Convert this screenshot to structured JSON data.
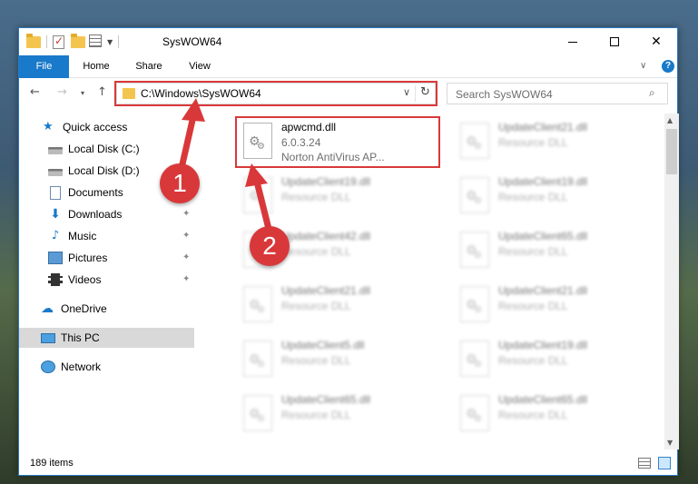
{
  "window": {
    "title": "SysWOW64",
    "minimize_icon": "minimize-icon",
    "maximize_icon": "maximize-icon",
    "close_icon": "close-icon",
    "close_glyph": "✕"
  },
  "ribbon": {
    "tabs": [
      {
        "label": "File"
      },
      {
        "label": "Home"
      },
      {
        "label": "Share"
      },
      {
        "label": "View"
      }
    ],
    "help_glyph": "?"
  },
  "nav": {
    "back_glyph": "←",
    "forward_glyph": "→",
    "recent_glyph": "▾",
    "up_glyph": "↑",
    "address": "C:\\Windows\\SysWOW64",
    "address_drop_glyph": "∨",
    "refresh_glyph": "↻",
    "search_placeholder": "Search SysWOW64",
    "search_glyph": "⌕"
  },
  "sidebar": {
    "items": [
      {
        "label": "Quick access",
        "icon": "star-icon",
        "pinned": false
      },
      {
        "label": "Local Disk (C:)",
        "icon": "disk-icon",
        "pinned": false
      },
      {
        "label": "Local Disk (D:)",
        "icon": "disk-icon",
        "pinned": false
      },
      {
        "label": "Documents",
        "icon": "documents-icon",
        "pinned": false
      },
      {
        "label": "Downloads",
        "icon": "downloads-icon",
        "pinned": true
      },
      {
        "label": "Music",
        "icon": "music-icon",
        "pinned": true
      },
      {
        "label": "Pictures",
        "icon": "pictures-icon",
        "pinned": true
      },
      {
        "label": "Videos",
        "icon": "videos-icon",
        "pinned": true
      },
      {
        "label": "OneDrive",
        "icon": "onedrive-icon",
        "pinned": false
      },
      {
        "label": "This PC",
        "icon": "this-pc-icon",
        "pinned": false,
        "selected": true
      },
      {
        "label": "Network",
        "icon": "network-icon",
        "pinned": false
      }
    ],
    "pin_glyph": "📌"
  },
  "files": {
    "highlighted": {
      "name": "apwcmd.dll",
      "version": "6.0.3.24",
      "description": "Norton AntiVirus AP..."
    },
    "blurred": [
      {
        "name": "UpdateClient21.dll",
        "description": "Resource DLL"
      },
      {
        "name": "UpdateClient19.dll",
        "description": "Resource DLL"
      },
      {
        "name": "UpdateClient19.dll",
        "description": "Resource DLL"
      },
      {
        "name": "UpdateClient42.dll",
        "description": "Resource DLL"
      },
      {
        "name": "UpdateClient65.dll",
        "description": "Resource DLL"
      },
      {
        "name": "UpdateClient21.dll",
        "description": "Resource DLL"
      },
      {
        "name": "UpdateClient21.dll",
        "description": "Resource DLL"
      },
      {
        "name": "UpdateClient5.dll",
        "description": "Resource DLL"
      },
      {
        "name": "UpdateClient19.dll",
        "description": "Resource DLL"
      },
      {
        "name": "UpdateClient65.dll",
        "description": "Resource DLL"
      },
      {
        "name": "UpdateClient65.dll",
        "description": "Resource DLL"
      }
    ]
  },
  "status": {
    "item_count": "189 items"
  },
  "annotations": {
    "step1": "1",
    "step2": "2",
    "color": "#d9383a"
  },
  "colors": {
    "accent": "#1979ca",
    "highlight_box": "#d9383a"
  }
}
